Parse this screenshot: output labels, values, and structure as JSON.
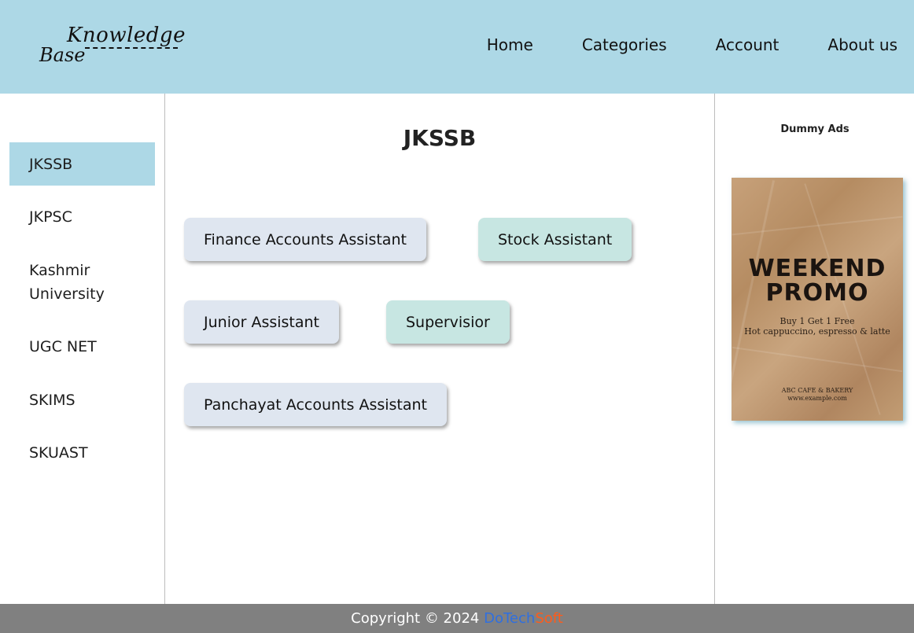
{
  "header": {
    "logo_top": "Knowledge",
    "logo_bottom": "Base",
    "nav": [
      "Home",
      "Categories",
      "Account",
      "About us"
    ]
  },
  "sidebar": {
    "items": [
      "JKSSB",
      "JKPSC",
      "Kashmir University",
      "UGC NET",
      "SKIMS",
      "SKUAST"
    ],
    "active": "JKSSB"
  },
  "main": {
    "title": "JKSSB",
    "posts": [
      "Finance Accounts Assistant",
      "Stock Assistant",
      "Junior Assistant",
      "Supervisior",
      "Panchayat Accounts Assistant"
    ]
  },
  "ads": {
    "title": "Dummy Ads",
    "promo": {
      "headline": "WEEKEND PROMO",
      "line1": "Buy 1 Get 1 Free",
      "line2": "Hot cappuccino, espresso & latte",
      "shop": "ABC CAFE & BAKERY",
      "url": "www.example.com"
    }
  },
  "footer": {
    "copyright": "Copyright © 2024",
    "brand_part1": "DoTech",
    "brand_part2": "Soft"
  },
  "colors": {
    "header_bg": "#add8e6",
    "active_item_bg": "#add8e6",
    "chip_blue": "#dfe6f0",
    "chip_teal": "#c7e6e2",
    "footer_bg": "#808080",
    "brand_blue": "#2f6fe0",
    "brand_orange": "#ff5b1a"
  }
}
